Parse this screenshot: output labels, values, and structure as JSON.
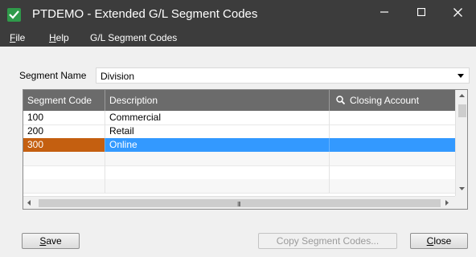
{
  "window": {
    "title": "PTDEMO - Extended G/L Segment Codes"
  },
  "menu": {
    "file_rest": "ile",
    "file_mnemonic": "F",
    "help_rest": "elp",
    "help_mnemonic": "H",
    "segment_codes": "G/L Segment Codes"
  },
  "segment": {
    "label": "Segment Name",
    "selected": "Division"
  },
  "grid": {
    "columns": [
      "Segment Code",
      "Description",
      "Closing Account"
    ],
    "rows": [
      {
        "code": "100",
        "description": "Commercial",
        "closing_account": ""
      },
      {
        "code": "200",
        "description": "Retail",
        "closing_account": ""
      },
      {
        "code": "300",
        "description": "Online",
        "closing_account": ""
      }
    ],
    "selected_row_index": 2,
    "hscroll_grip": "III"
  },
  "buttons": {
    "save_mnemonic": "S",
    "save_rest": "ave",
    "copy": "Copy Segment Codes...",
    "close_mnemonic": "C",
    "close_rest": "lose"
  },
  "colors": {
    "titlebar": "#3c3c3c",
    "selection": "#3399ff",
    "selected_code_cell": "#c45f10",
    "header": "#6b6b6b"
  },
  "icons": {
    "app": "app-icon",
    "search": "search-icon",
    "minimize": "minimize-icon",
    "maximize": "maximize-icon",
    "close": "close-icon"
  }
}
